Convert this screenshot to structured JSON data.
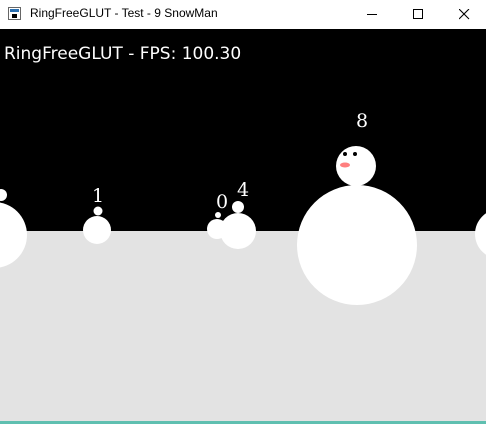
{
  "window": {
    "title": "RingFreeGLUT - Test - 9 SnowMan"
  },
  "scene": {
    "sky_color": "#000000",
    "ground_color": "#e3e3e3",
    "snow_color": "#ffffff",
    "nose_color": "#ff7f7f",
    "hud_text": "RingFreeGLUT - FPS: 100.30",
    "snowman_labels": [
      "1",
      "0",
      "4",
      "8"
    ]
  },
  "icons": {
    "minimize": "minimize-icon",
    "maximize": "maximize-icon",
    "close": "close-icon",
    "app": "app-window-icon"
  }
}
